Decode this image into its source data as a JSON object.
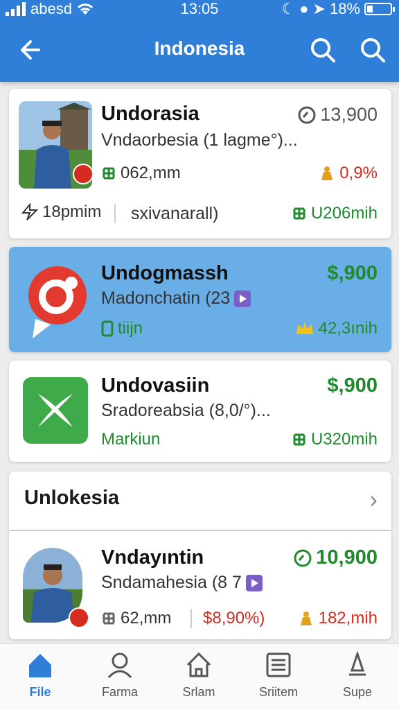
{
  "status": {
    "carrier": "abesd",
    "time": "13:05",
    "battery": "18%"
  },
  "appbar": {
    "title": "Indonesia",
    "back_icon": "arrow-left-icon"
  },
  "cards": [
    {
      "name": "Undorasia",
      "subtitle": "Vndaorbesia (1  lagme°)...",
      "stat": "13,900",
      "meta_left": "062,mm",
      "meta_right": "0,9%",
      "foot_left": "18pmim",
      "foot_mid": "sxivanarall)",
      "foot_right": "U206mih"
    },
    {
      "name": "Undogmassh",
      "subtitle": "Madonchatin (23",
      "price": "$,900",
      "meta_left": "tiijn",
      "meta_right": "42,3ınih"
    },
    {
      "name": "Undovasiin",
      "subtitle": "Sradoreabsia (8,0/°)...",
      "price": "$,900",
      "meta_left": "Markiun",
      "meta_right": "U320mih"
    }
  ],
  "section": {
    "title": "Unlokesia"
  },
  "card4": {
    "name": "Vndayıntin",
    "subtitle": "Sndamahesia (8 7",
    "stat": "10,900",
    "meta_a": "62,mm",
    "meta_b": "$8,90%)",
    "meta_c": "182,mih"
  },
  "nav": [
    {
      "label": "File",
      "icon": "home-icon",
      "active": true
    },
    {
      "label": "Farma",
      "icon": "person-icon",
      "active": false
    },
    {
      "label": "Srlam",
      "icon": "house-icon",
      "active": false
    },
    {
      "label": "Sriitem",
      "icon": "list-icon",
      "active": false
    },
    {
      "label": "Supe",
      "icon": "bell-icon",
      "active": false
    }
  ],
  "colors": {
    "primary": "#2f7fd8",
    "selected": "#6aaee8",
    "green": "#1f8a2e",
    "red": "#d62b1f"
  }
}
